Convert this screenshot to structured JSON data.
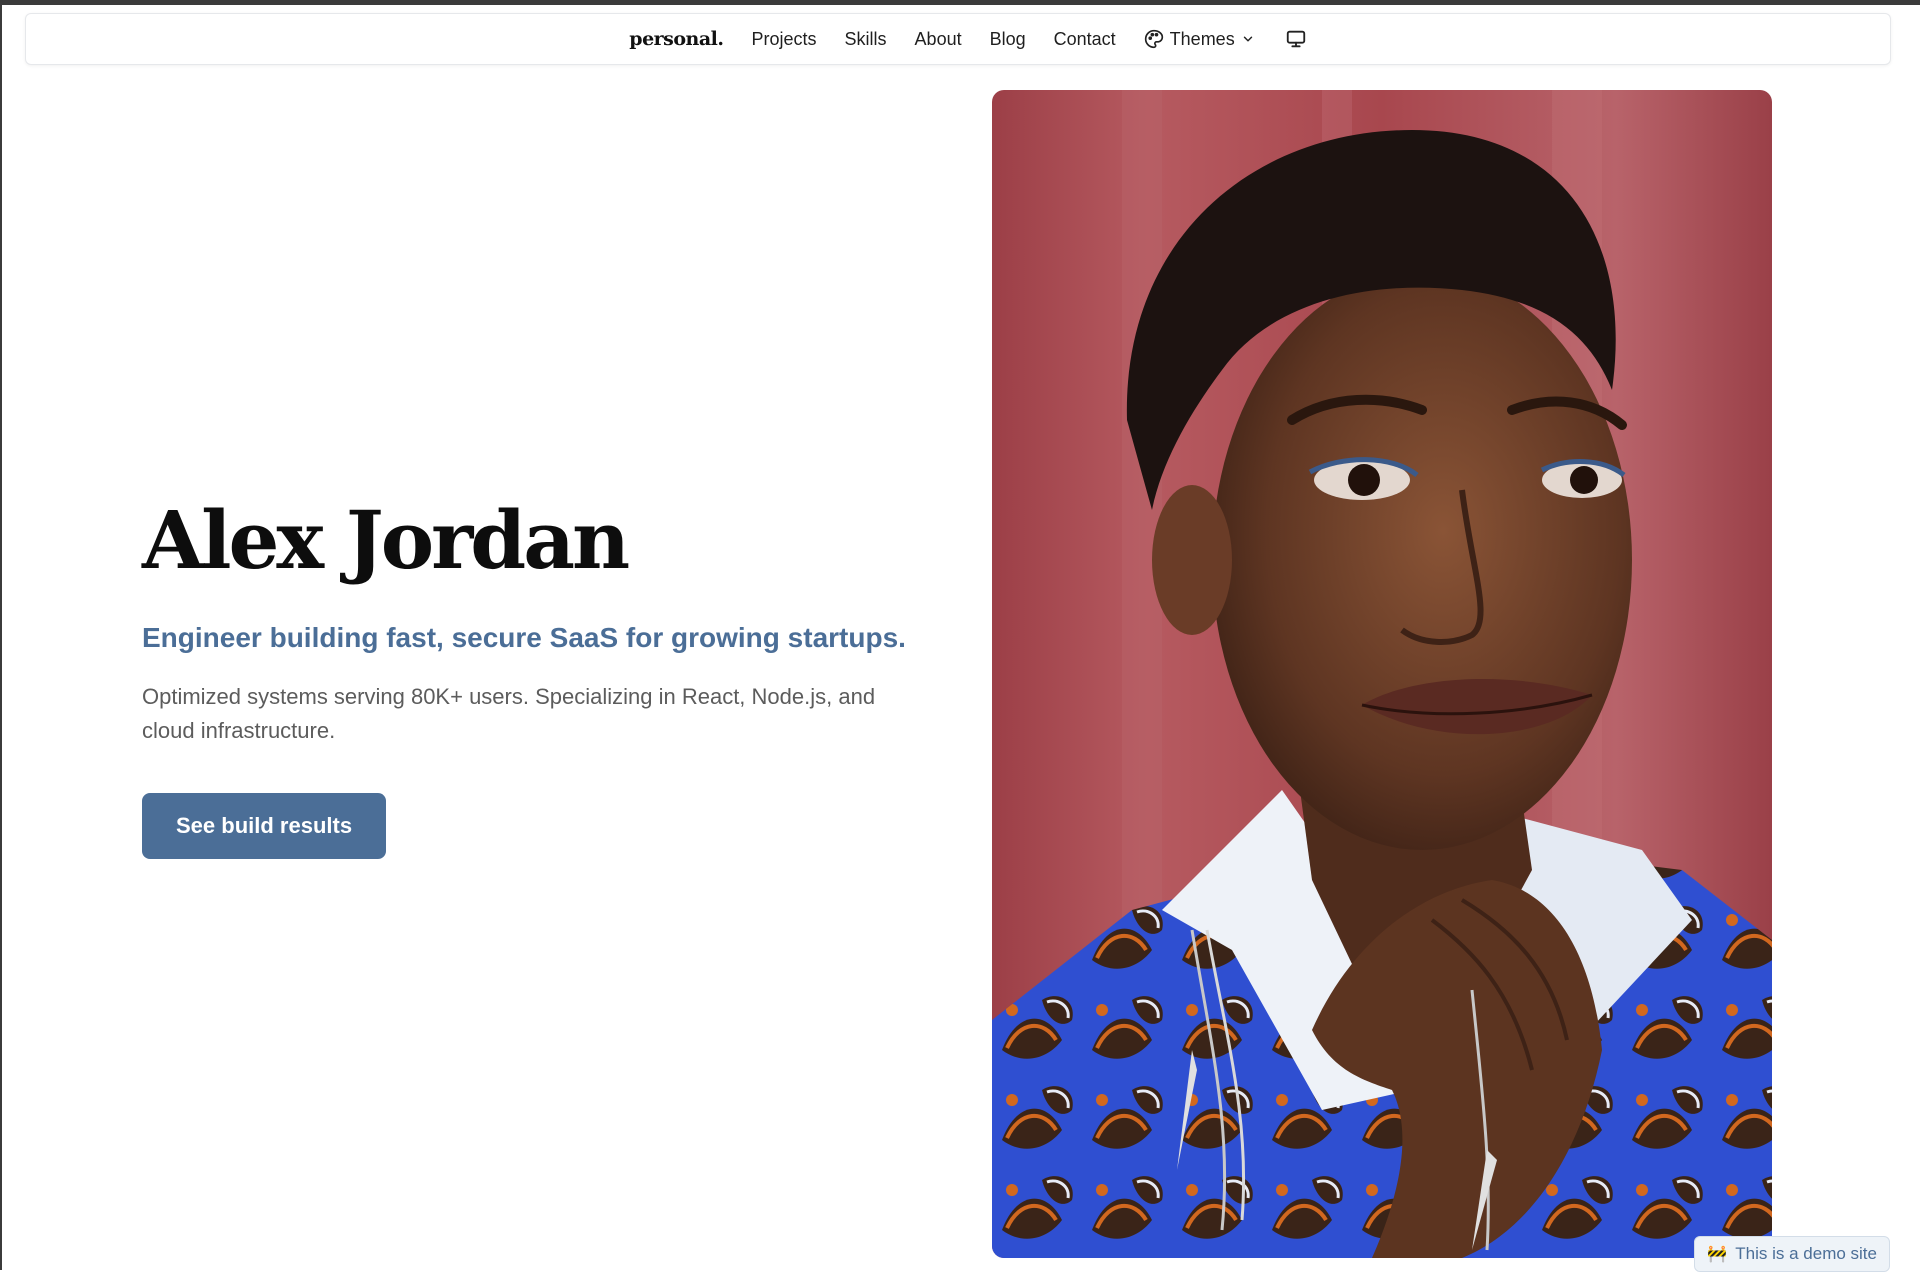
{
  "nav": {
    "brand": "personal.",
    "links": [
      "Projects",
      "Skills",
      "About",
      "Blog",
      "Contact"
    ],
    "themes_label": "Themes",
    "icons": {
      "themes": "palette-icon",
      "dropdown": "chevron-down-icon",
      "display": "monitor-icon"
    }
  },
  "hero": {
    "name": "Alex Jordan",
    "tagline": "Engineer building fast, secure SaaS for growing startups.",
    "description": "Optimized systems serving 80K+ users. Specializing in React, Node.js, and cloud infrastructure.",
    "cta_label": "See build results"
  },
  "badge": {
    "text": "This is a demo site",
    "icon": "🚧"
  },
  "colors": {
    "accent": "#4b6e97",
    "portrait_background": "#a84a4f"
  }
}
